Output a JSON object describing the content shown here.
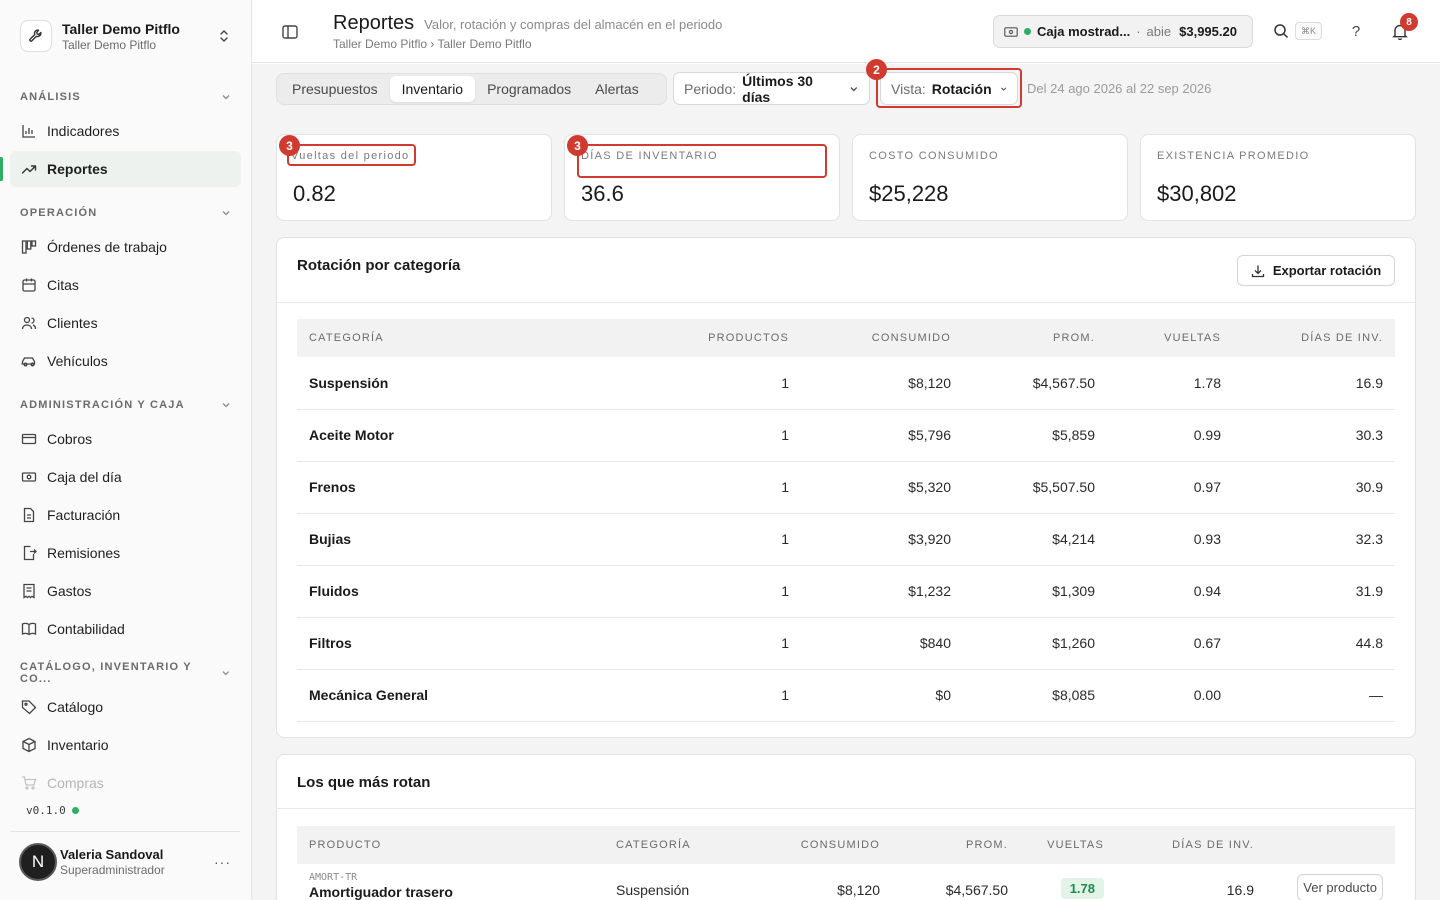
{
  "workspace": {
    "name": "Taller Demo Pitflo",
    "subtitle": "Taller Demo Pitflo"
  },
  "sidebar": {
    "sections": [
      {
        "title": "ANÁLISIS",
        "items": [
          {
            "label": "Indicadores",
            "icon": "bar-chart-icon"
          },
          {
            "label": "Reportes",
            "icon": "trend-icon",
            "active": true
          }
        ]
      },
      {
        "title": "OPERACIÓN",
        "items": [
          {
            "label": "Órdenes de trabajo",
            "icon": "kanban-icon"
          },
          {
            "label": "Citas",
            "icon": "calendar-icon"
          },
          {
            "label": "Clientes",
            "icon": "users-icon"
          },
          {
            "label": "Vehículos",
            "icon": "car-icon"
          }
        ]
      },
      {
        "title": "ADMINISTRACIÓN Y CAJA",
        "items": [
          {
            "label": "Cobros",
            "icon": "card-icon"
          },
          {
            "label": "Caja del día",
            "icon": "cash-icon"
          },
          {
            "label": "Facturación",
            "icon": "file-icon"
          },
          {
            "label": "Remisiones",
            "icon": "file-export-icon"
          },
          {
            "label": "Gastos",
            "icon": "receipt-icon"
          },
          {
            "label": "Contabilidad",
            "icon": "book-icon"
          }
        ]
      },
      {
        "title": "CATÁLOGO, INVENTARIO Y CO...",
        "items": [
          {
            "label": "Catálogo",
            "icon": "tag-icon"
          },
          {
            "label": "Inventario",
            "icon": "box-icon"
          },
          {
            "label": "Compras",
            "icon": "cart-icon"
          }
        ]
      }
    ],
    "version": "v0.1.0",
    "user": {
      "initial": "N",
      "name": "Valeria Sandoval",
      "role": "Superadministrador",
      "more": "···"
    }
  },
  "header": {
    "title": "Reportes",
    "description": "Valor, rotación y compras del almacén en el periodo",
    "breadcrumb": "Taller Demo Pitflo › Taller Demo Pitflo",
    "cash": {
      "name": "Caja mostrad...",
      "separator": "·",
      "status": "abie",
      "amount": "$3,995.20"
    },
    "shortcut": "⌘K",
    "help": "?",
    "notifications": "8"
  },
  "filters": {
    "tabs": [
      "Presupuestos",
      "Inventario",
      "Programados",
      "Alertas"
    ],
    "active_tab": "Inventario",
    "period": {
      "label": "Periodo:",
      "value": "Últimos 30 días"
    },
    "view": {
      "label": "Vista:",
      "value": "Rotación"
    },
    "date_range": "Del 24 ago 2026 al 22 sep 2026"
  },
  "markers": {
    "view": "2",
    "turns": "3",
    "days": "3"
  },
  "stats": [
    {
      "label": "Vueltas del periodo",
      "value": "0.82"
    },
    {
      "label": "DÍAS DE INVENTARIO",
      "value": "36.6"
    },
    {
      "label": "COSTO CONSUMIDO",
      "value": "$25,228"
    },
    {
      "label": "EXISTENCIA PROMEDIO",
      "value": "$30,802"
    }
  ],
  "rotation": {
    "title": "Rotación por categoría",
    "export_label": "Exportar rotación",
    "headers": [
      "CATEGORÍA",
      "PRODUCTOS",
      "CONSUMIDO",
      "PROM.",
      "VUELTAS",
      "DÍAS DE INV."
    ],
    "rows": [
      {
        "category": "Suspensión",
        "products": "1",
        "consumed": "$8,120",
        "avg": "$4,567.50",
        "turns": "1.78",
        "days": "16.9"
      },
      {
        "category": "Aceite Motor",
        "products": "1",
        "consumed": "$5,796",
        "avg": "$5,859",
        "turns": "0.99",
        "days": "30.3"
      },
      {
        "category": "Frenos",
        "products": "1",
        "consumed": "$5,320",
        "avg": "$5,507.50",
        "turns": "0.97",
        "days": "30.9"
      },
      {
        "category": "Bujias",
        "products": "1",
        "consumed": "$3,920",
        "avg": "$4,214",
        "turns": "0.93",
        "days": "32.3"
      },
      {
        "category": "Fluidos",
        "products": "1",
        "consumed": "$1,232",
        "avg": "$1,309",
        "turns": "0.94",
        "days": "31.9"
      },
      {
        "category": "Filtros",
        "products": "1",
        "consumed": "$840",
        "avg": "$1,260",
        "turns": "0.67",
        "days": "44.8"
      },
      {
        "category": "Mecánica General",
        "products": "1",
        "consumed": "$0",
        "avg": "$8,085",
        "turns": "0.00",
        "days": "—"
      }
    ]
  },
  "top_rotating": {
    "title": "Los que más rotan",
    "headers": [
      "PRODUCTO",
      "CATEGORÍA",
      "CONSUMIDO",
      "PROM.",
      "VUELTAS",
      "DÍAS DE INV."
    ],
    "rows": [
      {
        "sku": "AMORT-TR",
        "name": "Amortiguador trasero",
        "category": "Suspensión",
        "consumed": "$8,120",
        "avg": "$4,567.50",
        "turns": "1.78",
        "days": "16.9",
        "action": "Ver producto"
      }
    ]
  },
  "colors": {
    "accent": "#2eae63",
    "marker": "#d13a2f",
    "pill_bg": "#e2f4e8",
    "pill_text": "#1f8a4a"
  }
}
